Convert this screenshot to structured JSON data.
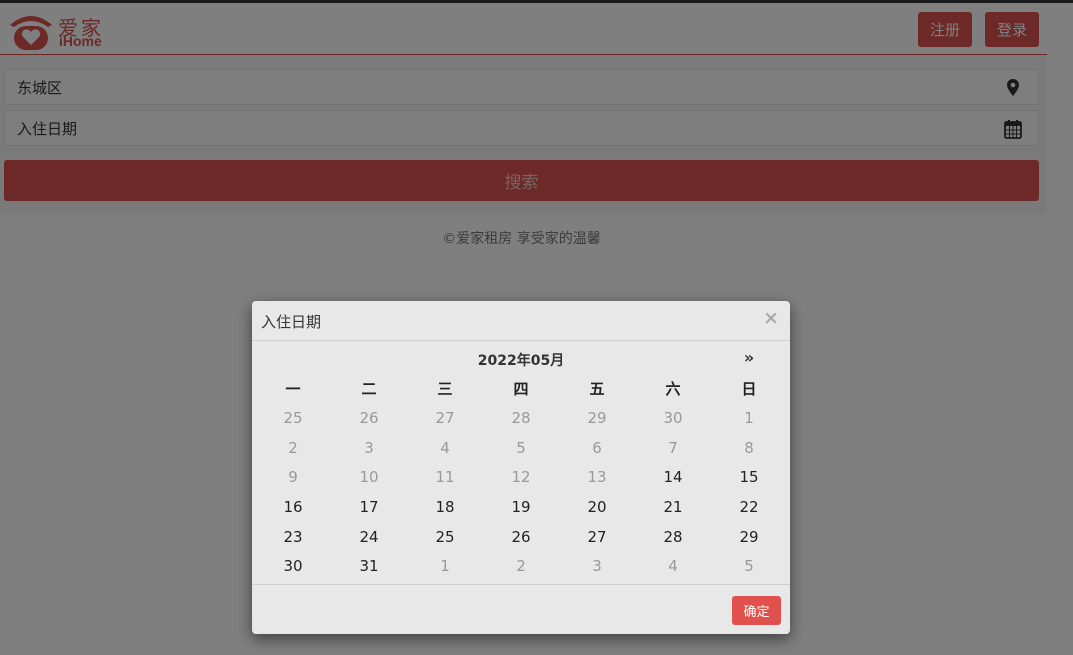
{
  "header": {
    "logo_cn": "爱家",
    "logo_en": "iHome",
    "register_label": "注册",
    "login_label": "登录"
  },
  "search": {
    "area_value": "东城区",
    "date_placeholder": "入住日期",
    "search_label": "搜索"
  },
  "footer": {
    "text": "©爱家租房  享受家的温馨"
  },
  "modal": {
    "title": "入住日期",
    "close": "×",
    "confirm_label": "确定"
  },
  "calendar": {
    "month_label": "2022年05月",
    "next_label": "»",
    "weekdays": [
      "一",
      "二",
      "三",
      "四",
      "五",
      "六",
      "日"
    ],
    "days": [
      {
        "label": "25",
        "muted": true
      },
      {
        "label": "26",
        "muted": true
      },
      {
        "label": "27",
        "muted": true
      },
      {
        "label": "28",
        "muted": true
      },
      {
        "label": "29",
        "muted": true
      },
      {
        "label": "30",
        "muted": true
      },
      {
        "label": "1",
        "muted": true
      },
      {
        "label": "2",
        "muted": true
      },
      {
        "label": "3",
        "muted": true
      },
      {
        "label": "4",
        "muted": true
      },
      {
        "label": "5",
        "muted": true
      },
      {
        "label": "6",
        "muted": true
      },
      {
        "label": "7",
        "muted": true
      },
      {
        "label": "8",
        "muted": true
      },
      {
        "label": "9",
        "muted": true
      },
      {
        "label": "10",
        "muted": true
      },
      {
        "label": "11",
        "muted": true
      },
      {
        "label": "12",
        "muted": true
      },
      {
        "label": "13",
        "muted": true
      },
      {
        "label": "14",
        "muted": false
      },
      {
        "label": "15",
        "muted": false
      },
      {
        "label": "16",
        "muted": false
      },
      {
        "label": "17",
        "muted": false
      },
      {
        "label": "18",
        "muted": false
      },
      {
        "label": "19",
        "muted": false
      },
      {
        "label": "20",
        "muted": false
      },
      {
        "label": "21",
        "muted": false
      },
      {
        "label": "22",
        "muted": false
      },
      {
        "label": "23",
        "muted": false
      },
      {
        "label": "24",
        "muted": false
      },
      {
        "label": "25",
        "muted": false
      },
      {
        "label": "26",
        "muted": false
      },
      {
        "label": "27",
        "muted": false
      },
      {
        "label": "28",
        "muted": false
      },
      {
        "label": "29",
        "muted": false
      },
      {
        "label": "30",
        "muted": false
      },
      {
        "label": "31",
        "muted": false
      },
      {
        "label": "1",
        "muted": true
      },
      {
        "label": "2",
        "muted": true
      },
      {
        "label": "3",
        "muted": true
      },
      {
        "label": "4",
        "muted": true
      },
      {
        "label": "5",
        "muted": true
      }
    ]
  },
  "colors": {
    "brand": "#d9534f",
    "overlay": "rgba(0,0,0,0.5)"
  },
  "icons": {
    "location": "map-marker-icon",
    "calendar": "calendar-icon"
  }
}
